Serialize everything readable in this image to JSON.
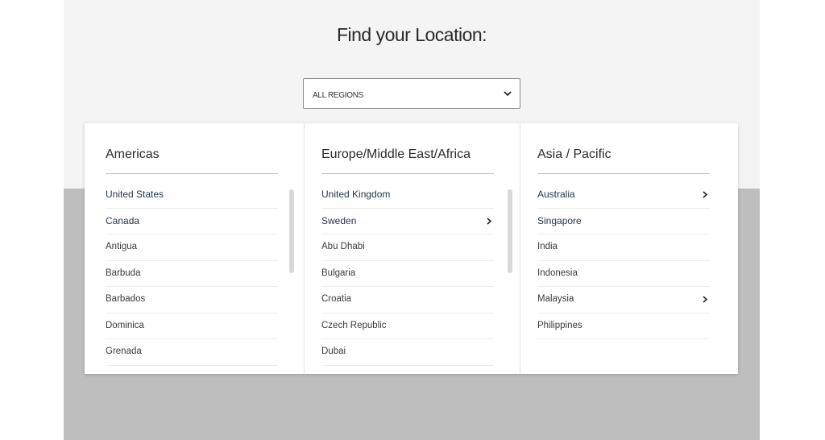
{
  "page": {
    "title": "Find your Location:"
  },
  "region_select": {
    "value": "ALL REGIONS"
  },
  "columns": [
    {
      "heading": "Americas",
      "items": [
        {
          "label": "United States",
          "primary": true,
          "has_submenu": false
        },
        {
          "label": "Canada",
          "primary": true,
          "has_submenu": false
        },
        {
          "label": "Antigua",
          "primary": false,
          "has_submenu": false
        },
        {
          "label": "Barbuda",
          "primary": false,
          "has_submenu": false
        },
        {
          "label": "Barbados",
          "primary": false,
          "has_submenu": false
        },
        {
          "label": "Dominica",
          "primary": false,
          "has_submenu": false
        },
        {
          "label": "Grenada",
          "primary": false,
          "has_submenu": false
        }
      ],
      "scrollable": true
    },
    {
      "heading": "Europe/Middle East/Africa",
      "items": [
        {
          "label": "United Kingdom",
          "primary": true,
          "has_submenu": false
        },
        {
          "label": "Sweden",
          "primary": true,
          "has_submenu": true
        },
        {
          "label": "Abu Dhabi",
          "primary": false,
          "has_submenu": false
        },
        {
          "label": "Bulgaria",
          "primary": false,
          "has_submenu": false
        },
        {
          "label": "Croatia",
          "primary": false,
          "has_submenu": false
        },
        {
          "label": "Czech Republic",
          "primary": false,
          "has_submenu": false
        },
        {
          "label": "Dubai",
          "primary": false,
          "has_submenu": false
        }
      ],
      "scrollable": true
    },
    {
      "heading": "Asia / Pacific",
      "items": [
        {
          "label": "Australia",
          "primary": true,
          "has_submenu": true
        },
        {
          "label": "Singapore",
          "primary": true,
          "has_submenu": false
        },
        {
          "label": "India",
          "primary": false,
          "has_submenu": false
        },
        {
          "label": "Indonesia",
          "primary": false,
          "has_submenu": false
        },
        {
          "label": "Malaysia",
          "primary": false,
          "has_submenu": true
        },
        {
          "label": "Philippines",
          "primary": false,
          "has_submenu": false
        }
      ],
      "scrollable": false
    }
  ],
  "colors": {
    "page_bg": "#bebebe",
    "band_bg": "#f4f4f4",
    "primary_text": "#23374d"
  },
  "icons": {
    "select": "chevron-down-icon",
    "submenu": "chevron-right-icon"
  }
}
